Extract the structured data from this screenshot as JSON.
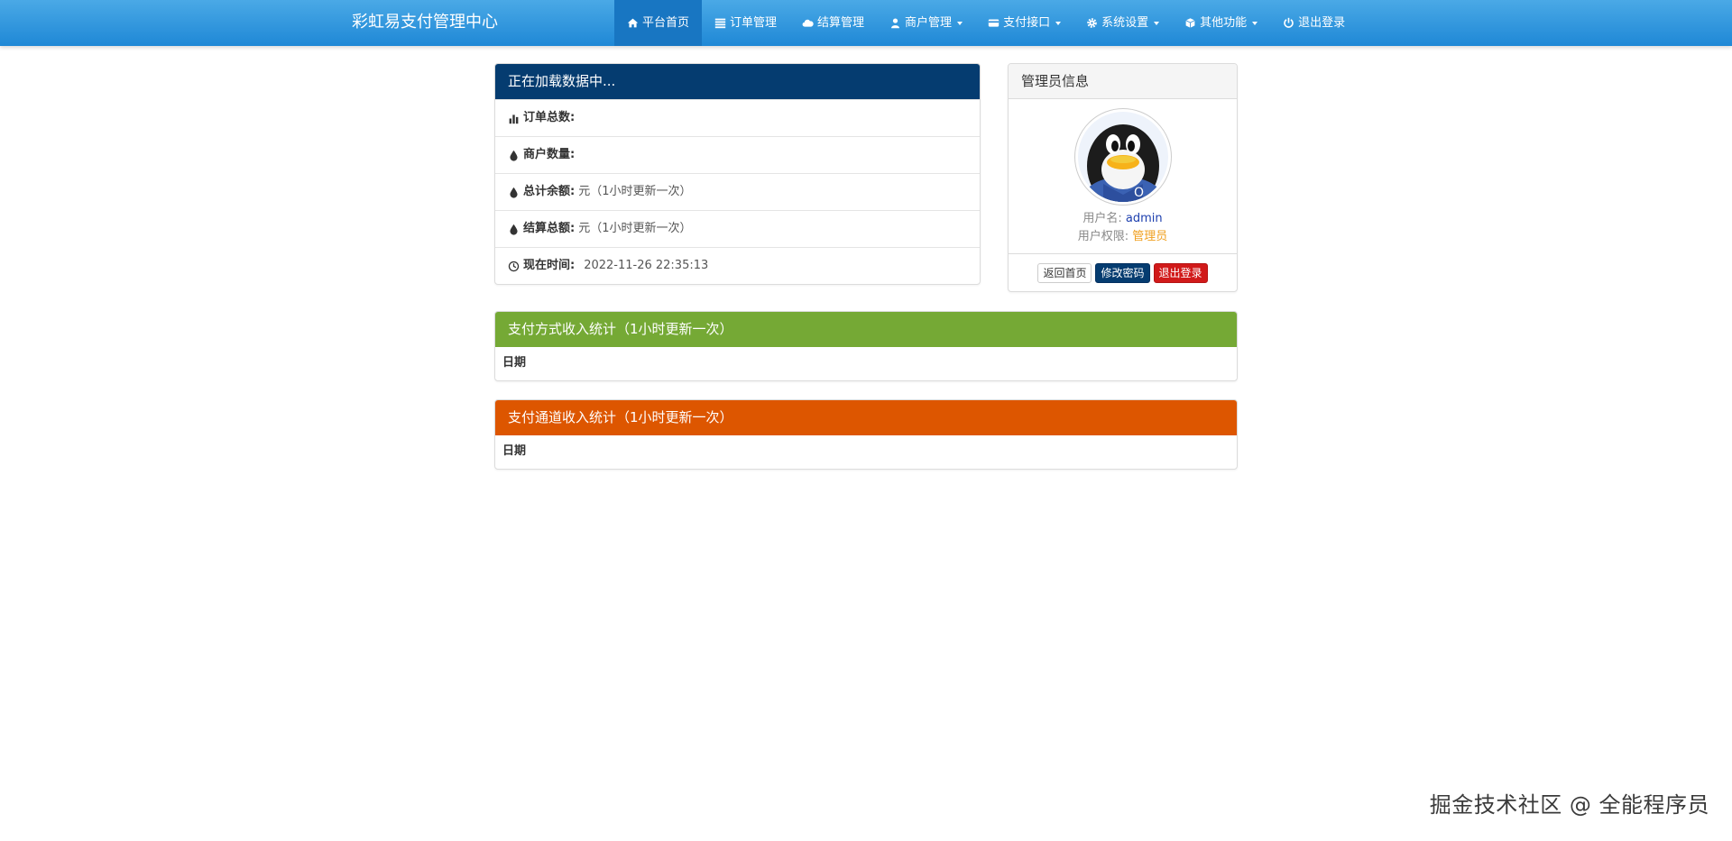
{
  "navbar": {
    "brand": "彩虹易支付管理中心",
    "items": [
      {
        "label": "平台首页",
        "icon": "home-icon",
        "active": true
      },
      {
        "label": "订单管理",
        "icon": "list-icon"
      },
      {
        "label": "结算管理",
        "icon": "cloud-icon"
      },
      {
        "label": "商户管理",
        "icon": "user-icon",
        "dropdown": true
      },
      {
        "label": "支付接口",
        "icon": "credit-card-icon",
        "dropdown": true
      },
      {
        "label": "系统设置",
        "icon": "gear-icon",
        "dropdown": true
      },
      {
        "label": "其他功能",
        "icon": "cube-icon",
        "dropdown": true
      },
      {
        "label": "退出登录",
        "icon": "power-icon"
      }
    ]
  },
  "stats": {
    "title": "正在加载数据中...",
    "rows": [
      {
        "label": "订单总数:",
        "value": "",
        "icon": "bar-chart-icon"
      },
      {
        "label": "商户数量:",
        "value": "",
        "icon": "tint-icon"
      },
      {
        "label": "总计余额:",
        "value": "元（1小时更新一次）",
        "icon": "tint-icon"
      },
      {
        "label": "结算总额:",
        "value": "元（1小时更新一次）",
        "icon": "tint-icon"
      },
      {
        "label": "现在时间:",
        "value": "2022-11-26 22:35:13",
        "icon": "clock-icon"
      }
    ]
  },
  "admin": {
    "title": "管理员信息",
    "username_label": "用户名:",
    "username": "admin",
    "role_label": "用户权限:",
    "role": "管理员",
    "buttons": {
      "home": "返回首页",
      "password": "修改密码",
      "logout": "退出登录"
    }
  },
  "pay_stats": {
    "title": "支付方式收入统计（1小时更新一次）",
    "col": "日期"
  },
  "channel_stats": {
    "title": "支付通道收入统计（1小时更新一次）",
    "col": "日期"
  },
  "watermark": "掘金技术社区 @ 全能程序员",
  "colors": {
    "navbar": "#2a94dc",
    "stats_header": "#053c70",
    "pay_header": "#75a935",
    "channel_header": "#dd5600",
    "danger": "#d11a1a"
  }
}
